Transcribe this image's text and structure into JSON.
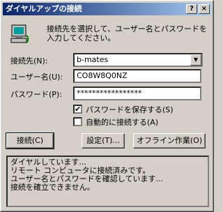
{
  "window": {
    "title": "ダイヤルアップの接続"
  },
  "description": "接続先を選択して、ユーザー名とパスワードを入力してください。",
  "form": {
    "connection_label": "接続先(N):",
    "connection_value": "b-mates",
    "username_label": "ユーザー名(U):",
    "username_value": "CO8W8Q0NZ",
    "password_label": "パスワード(P):",
    "password_value": "*****************",
    "save_password_label": "パスワードを保存する(S)",
    "save_password_checked": true,
    "auto_connect_label": "自動的に接続する(A)",
    "auto_connect_checked": false
  },
  "buttons": {
    "connect": "接続(C)",
    "settings": "設定(T)...",
    "offline": "オフライン作業(O)"
  },
  "status_lines": [
    "ダイヤルしています...",
    "リモート コンピュータに接続済みです。",
    "ユーザー名とパスワードを確認しています...",
    "接続を確立できません。"
  ],
  "icons": {
    "help": "help-icon",
    "close": "close-icon",
    "computer": "computer-icon",
    "dropdown": "chevron-down-icon",
    "check": "checkmark"
  }
}
